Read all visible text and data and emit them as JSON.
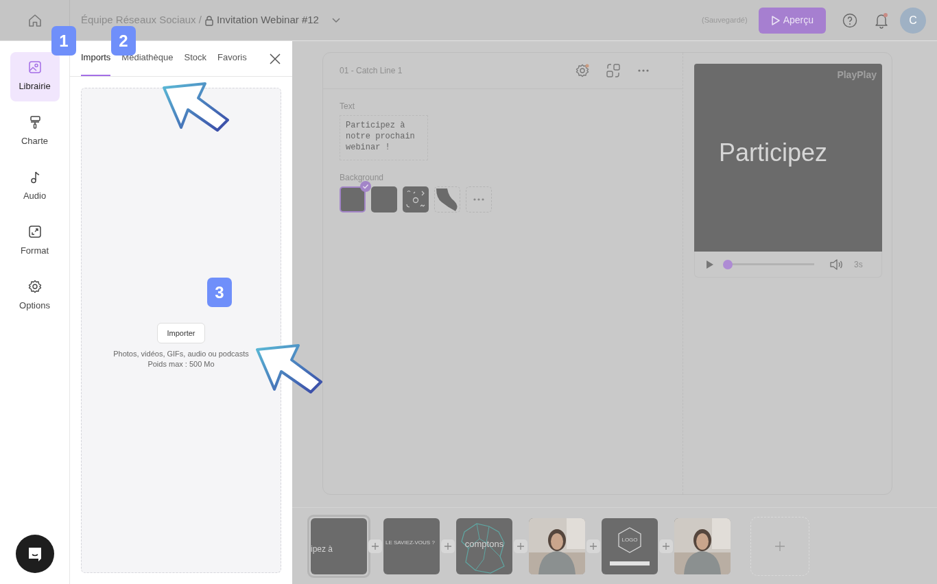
{
  "topbar": {
    "team": "Équipe Réseaux Sociaux /",
    "project": "Invitation Webinar #12",
    "save_status": "(Sauvegardé)",
    "preview_button": "Aperçu",
    "has_notification": true,
    "avatar": "C"
  },
  "sidebar": {
    "items": [
      {
        "label": "Librairie",
        "selected": true
      },
      {
        "label": "Charte",
        "selected": false
      },
      {
        "label": "Audio",
        "selected": false
      },
      {
        "label": "Format",
        "selected": false
      },
      {
        "label": "Options",
        "selected": false
      }
    ]
  },
  "library_panel": {
    "tabs": [
      {
        "label": "Imports",
        "selected": true
      },
      {
        "label": "Médiathèque",
        "selected": false
      },
      {
        "label": "Stock",
        "selected": false
      },
      {
        "label": "Favoris",
        "selected": false
      }
    ],
    "import_button": "Importer",
    "hint_lines": [
      "Photos, vidéos, GIFs, audio ou podcasts",
      "Poids max : 500 Mo"
    ]
  },
  "editor": {
    "scene_title": "01 - Catch Line 1",
    "settings_has_notification": true,
    "text_label": "Text",
    "text_value": "Participez à\nnotre prochain\nwebinar !",
    "background_label": "Background",
    "backgrounds": [
      {
        "kind": "plain",
        "selected": true
      },
      {
        "kind": "plain",
        "selected": false
      },
      {
        "kind": "pattern",
        "selected": false
      },
      {
        "kind": "shape",
        "selected": false
      },
      {
        "kind": "more",
        "selected": false
      }
    ]
  },
  "preview": {
    "watermark": "PlayPlay",
    "headline": "Participez",
    "level": 0.03,
    "duration": "3s"
  },
  "timeline": {
    "scenes": [
      {
        "kind": "text",
        "caption": "ipez à",
        "selected": true
      },
      {
        "kind": "text",
        "caption": "LE SAVIEZ-VOUS ?",
        "selected": false
      },
      {
        "kind": "map",
        "caption": "comptons",
        "selected": false
      },
      {
        "kind": "picture",
        "selected": false
      },
      {
        "kind": "logo",
        "caption": "LOGO",
        "selected": false
      },
      {
        "kind": "picture",
        "selected": false
      }
    ]
  },
  "annotations": [
    {
      "label": "1"
    },
    {
      "label": "2"
    },
    {
      "label": "3"
    }
  ]
}
